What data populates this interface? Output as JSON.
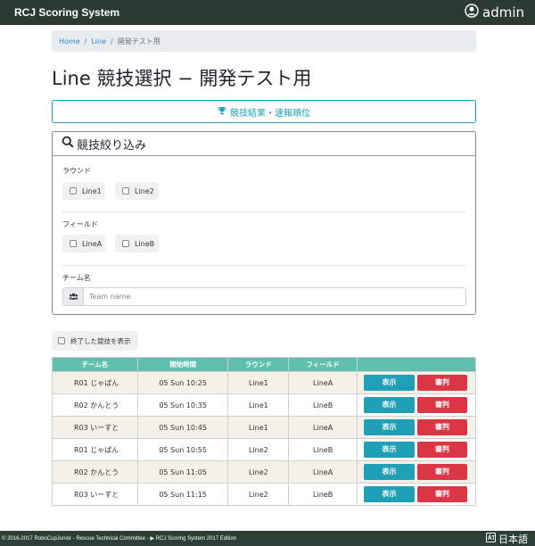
{
  "navbar": {
    "brand": "RCJ Scoring System",
    "user": "admin"
  },
  "breadcrumb": {
    "home": "Home",
    "line": "Line",
    "current": "開発テスト用"
  },
  "page_title": "Line 競技選択 − 開発テスト用",
  "results_button": "競技結果・速報順位",
  "filter": {
    "title": "競技絞り込み",
    "round_label": "ラウンド",
    "rounds": [
      "Line1",
      "Line2"
    ],
    "field_label": "フィールド",
    "fields": [
      "LineA",
      "LineB"
    ],
    "team_label": "チーム名",
    "team_placeholder": "Team name"
  },
  "show_finished": "終了した競技を表示",
  "table": {
    "headers": [
      "チーム名",
      "開始時間",
      "ラウンド",
      "フィールド",
      ""
    ],
    "rows": [
      [
        "R01 じゃぱん",
        "05 Sun 10:25",
        "Line1",
        "LineA"
      ],
      [
        "R02 かんとう",
        "05 Sun 10:35",
        "Line1",
        "LineB"
      ],
      [
        "R03 いーすと",
        "05 Sun 10:45",
        "Line1",
        "LineA"
      ],
      [
        "R01 じゃぱん",
        "05 Sun 10:55",
        "Line2",
        "LineB"
      ],
      [
        "R02 かんとう",
        "05 Sun 11:05",
        "Line2",
        "LineA"
      ],
      [
        "R03 いーすと",
        "05 Sun 11:15",
        "Line2",
        "LineB"
      ]
    ],
    "view_label": "表示",
    "judge_label": "審判"
  },
  "footer": {
    "copyright": "© 2016-2017 RoboCupJunior - Rescue Technical Committee - ▶ RCJ Scoring System 2017 Edition",
    "language": "日本語"
  },
  "colors": {
    "navbar": "#2b3b32",
    "accent": "#17a2b8",
    "table_header": "#5fc0ad",
    "danger": "#dc3545",
    "row_stripe": "#f4f1e8"
  },
  "icons": [
    "user-circle-icon",
    "trophy-icon",
    "search-icon",
    "users-icon",
    "language-icon"
  ]
}
